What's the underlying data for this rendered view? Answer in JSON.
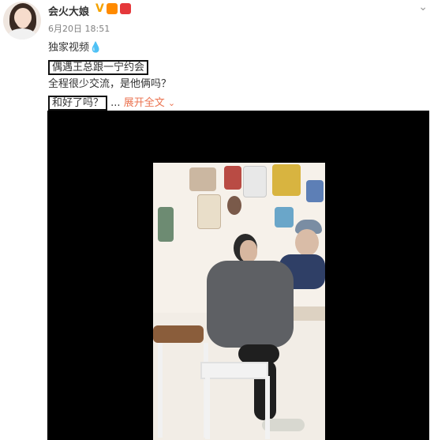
{
  "post": {
    "username": "会火大娘",
    "verified_mark": "V",
    "time": "6月20日 18:51"
  },
  "content": {
    "line1": "独家视频💧",
    "line2": "偶遇王总跟一宁约会",
    "line3": "全程很少交流，是他俩吗？",
    "line4_boxed": "和好了吗？",
    "line4_ellipsis": "...",
    "expand_label": "展开全文",
    "expand_icon": "chevron-down"
  },
  "colors": {
    "accent_orange": "#eb7350",
    "verified_gold": "#f5a300"
  }
}
